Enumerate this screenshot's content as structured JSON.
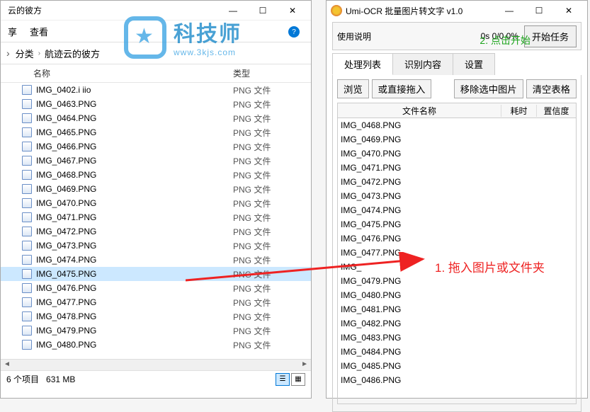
{
  "explorer": {
    "title": "云的彼方",
    "menu": {
      "share": "享",
      "view": "查看"
    },
    "breadcrumb": {
      "category": "分类",
      "folder": "航迹云的彼方"
    },
    "columns": {
      "name": "名称",
      "type": "类型"
    },
    "files": [
      {
        "name": "IMG_0402.i iio",
        "type": "PNG 文件",
        "cut": true
      },
      {
        "name": "IMG_0463.PNG",
        "type": "PNG 文件"
      },
      {
        "name": "IMG_0464.PNG",
        "type": "PNG 文件"
      },
      {
        "name": "IMG_0465.PNG",
        "type": "PNG 文件"
      },
      {
        "name": "IMG_0466.PNG",
        "type": "PNG 文件"
      },
      {
        "name": "IMG_0467.PNG",
        "type": "PNG 文件"
      },
      {
        "name": "IMG_0468.PNG",
        "type": "PNG 文件"
      },
      {
        "name": "IMG_0469.PNG",
        "type": "PNG 文件"
      },
      {
        "name": "IMG_0470.PNG",
        "type": "PNG 文件"
      },
      {
        "name": "IMG_0471.PNG",
        "type": "PNG 文件"
      },
      {
        "name": "IMG_0472.PNG",
        "type": "PNG 文件"
      },
      {
        "name": "IMG_0473.PNG",
        "type": "PNG 文件"
      },
      {
        "name": "IMG_0474.PNG",
        "type": "PNG 文件"
      },
      {
        "name": "IMG_0475.PNG",
        "type": "PNG 文件",
        "selected": true
      },
      {
        "name": "IMG_0476.PNG",
        "type": "PNG 文件"
      },
      {
        "name": "IMG_0477.PNG",
        "type": "PNG 文件"
      },
      {
        "name": "IMG_0478.PNG",
        "type": "PNG 文件"
      },
      {
        "name": "IMG_0479.PNG",
        "type": "PNG 文件"
      },
      {
        "name": "IMG_0480.PNG",
        "type": "PNG 文件"
      }
    ],
    "status": {
      "count": "6 个项目",
      "size": "631 MB"
    }
  },
  "ocr": {
    "title": "Umi-OCR 批量图片转文字 v1.0",
    "toolbar": {
      "usage": "使用说明",
      "stats": "0s    0/0   0%",
      "start": "开始任务"
    },
    "tabs": {
      "queue": "处理列表",
      "result": "识别内容",
      "settings": "设置"
    },
    "actions": {
      "browse": "浏览",
      "drag": "或直接拖入",
      "remove": "移除选中图片",
      "clear": "清空表格"
    },
    "table": {
      "name": "文件名称",
      "time": "耗时",
      "conf": "置信度"
    },
    "files": [
      "IMG_0468.PNG",
      "IMG_0469.PNG",
      "IMG_0470.PNG",
      "IMG_0471.PNG",
      "IMG_0472.PNG",
      "IMG_0473.PNG",
      "IMG_0474.PNG",
      "IMG_0475.PNG",
      "IMG_0476.PNG",
      "IMG_0477.PNG",
      "IMG_",
      "IMG_0479.PNG",
      "IMG_0480.PNG",
      "IMG_0481.PNG",
      "IMG_0482.PNG",
      "IMG_0483.PNG",
      "IMG_0484.PNG",
      "IMG_0485.PNG",
      "IMG_0486.PNG"
    ]
  },
  "annotations": {
    "step1": "1. 拖入图片或文件夹",
    "step2": "2. 点击开始",
    "watermark_big": "科技师",
    "watermark_small": "www.3kjs.com"
  }
}
